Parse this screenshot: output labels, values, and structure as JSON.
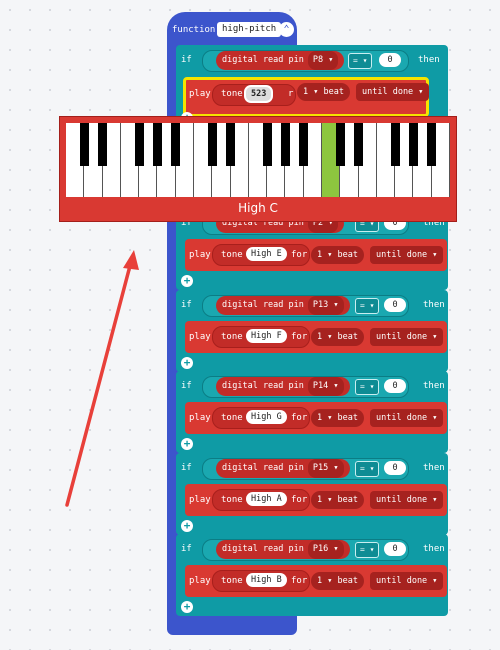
{
  "function_block": {
    "keyword": "function",
    "name": "high-pitch",
    "collapse_icon": "chevron-up-icon"
  },
  "labels": {
    "if": "if",
    "then": "then",
    "play": "play",
    "tone": "tone",
    "for": "for",
    "read": "digital read pin",
    "eq": "=",
    "until_done": "until done"
  },
  "rows": [
    {
      "pin": "P8",
      "value": "0",
      "note": "523",
      "beat": "1",
      "unit": "beat"
    },
    {
      "pin": "P2",
      "value": "0",
      "note": "High E",
      "beat": "1",
      "unit": "beat"
    },
    {
      "pin": "P13",
      "value": "0",
      "note": "High F",
      "beat": "1",
      "unit": "beat"
    },
    {
      "pin": "P14",
      "value": "0",
      "note": "High G",
      "beat": "1",
      "unit": "beat"
    },
    {
      "pin": "P15",
      "value": "0",
      "note": "High A",
      "beat": "1",
      "unit": "beat"
    },
    {
      "pin": "P16",
      "value": "0",
      "note": "High B",
      "beat": "1",
      "unit": "beat"
    }
  ],
  "piano": {
    "selected_note": "High C",
    "accent_color": "#8dc63f",
    "panel_color": "#d93932"
  },
  "colors": {
    "function": "#3c55cc",
    "logic": "#0f9ba5",
    "music": "#d93932",
    "highlight": "#f5e400",
    "arrow": "#e8403a"
  }
}
